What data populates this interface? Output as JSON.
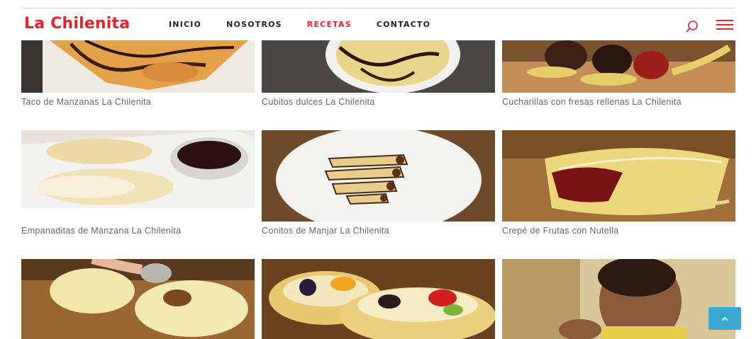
{
  "header": {
    "logo": "La Chilenita",
    "nav": [
      {
        "label": "INICIO"
      },
      {
        "label": "NOSOTROS"
      },
      {
        "label": "RECETAS"
      },
      {
        "label": "CONTACTO"
      }
    ],
    "active_nav": "RECETAS",
    "search_icon": "search-icon",
    "menu_icon": "hamburger-menu-icon"
  },
  "recipes": [
    {
      "title": "Taco de Manzanas La Chilenita"
    },
    {
      "title": "Cubitos dulces La Chilenita"
    },
    {
      "title": "Cucharillas con fresas rellenas La Chilenita"
    },
    {
      "title": "Empanaditas de Manzana La Chilenita"
    },
    {
      "title": "Conitos de Manjar La Chilenita"
    },
    {
      "title": "Crepé de Frutas con Nutella"
    },
    {
      "title": ""
    },
    {
      "title": ""
    },
    {
      "title": ""
    }
  ],
  "scroll_top": {
    "icon": "chevron-up-icon"
  },
  "colors": {
    "brand": "#e3242b",
    "accent": "#3aaad2",
    "text": "#666666",
    "nav_text": "#222222"
  }
}
